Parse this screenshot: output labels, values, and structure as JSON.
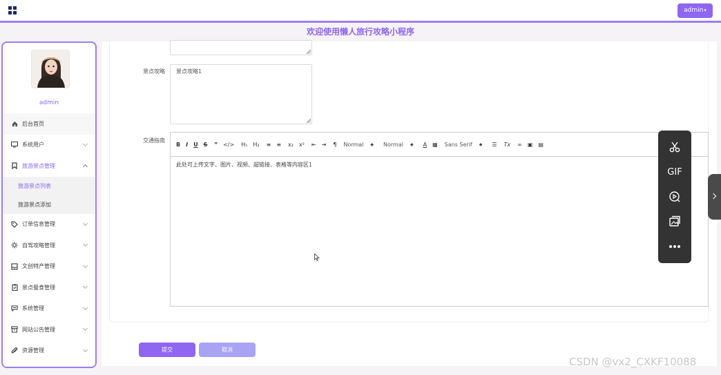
{
  "header": {
    "admin_button": "admin",
    "title": "欢迎使用懒人旅行攻略小程序"
  },
  "sidebar": {
    "user_name": "admin",
    "items": [
      {
        "label": "后台首页",
        "icon": "home-icon"
      },
      {
        "label": "系统用户",
        "icon": "monitor-icon"
      },
      {
        "label": "旅游景点管理",
        "icon": "bookmark-icon",
        "expanded": true
      },
      {
        "label": "订单信息管理",
        "icon": "tag-icon"
      },
      {
        "label": "自驾攻略管理",
        "icon": "sun-icon"
      },
      {
        "label": "文创特产管理",
        "icon": "inbox-icon"
      },
      {
        "label": "景点餐食管理",
        "icon": "clipboard-icon"
      },
      {
        "label": "系统管理",
        "icon": "message-icon"
      },
      {
        "label": "网站公告管理",
        "icon": "archive-icon"
      },
      {
        "label": "资源管理",
        "icon": "paperclip-icon"
      }
    ],
    "subitems": [
      {
        "label": "旅游景点列表",
        "active": true
      },
      {
        "label": "旅游景点添加",
        "active": false
      }
    ]
  },
  "form": {
    "guide_label": "景点攻略",
    "guide_value": "景点攻略1",
    "traffic_label": "交通指南",
    "editor_placeholder": "此处可上传文字、图片、视频、超链接、表格等内容区1",
    "toolbar": {
      "bold": "B",
      "italic": "I",
      "underline": "U",
      "strike": "S",
      "quote": "❞",
      "code": "</>",
      "h1": "H₁",
      "h2": "H₂",
      "sub": "x₂",
      "sup": "x²",
      "size_select": "Normal",
      "header_select": "Normal",
      "font_select": "Sans Serif",
      "clear": "Tx"
    },
    "submit_label": "提交",
    "cancel_label": "取消"
  },
  "floatbar": {
    "gif_label": "GIF"
  },
  "watermark": "CSDN @vx2_CXKF10088",
  "colors": {
    "accent": "#8f66f2",
    "accent_light": "#a9a3f4",
    "dark": "#333333"
  }
}
